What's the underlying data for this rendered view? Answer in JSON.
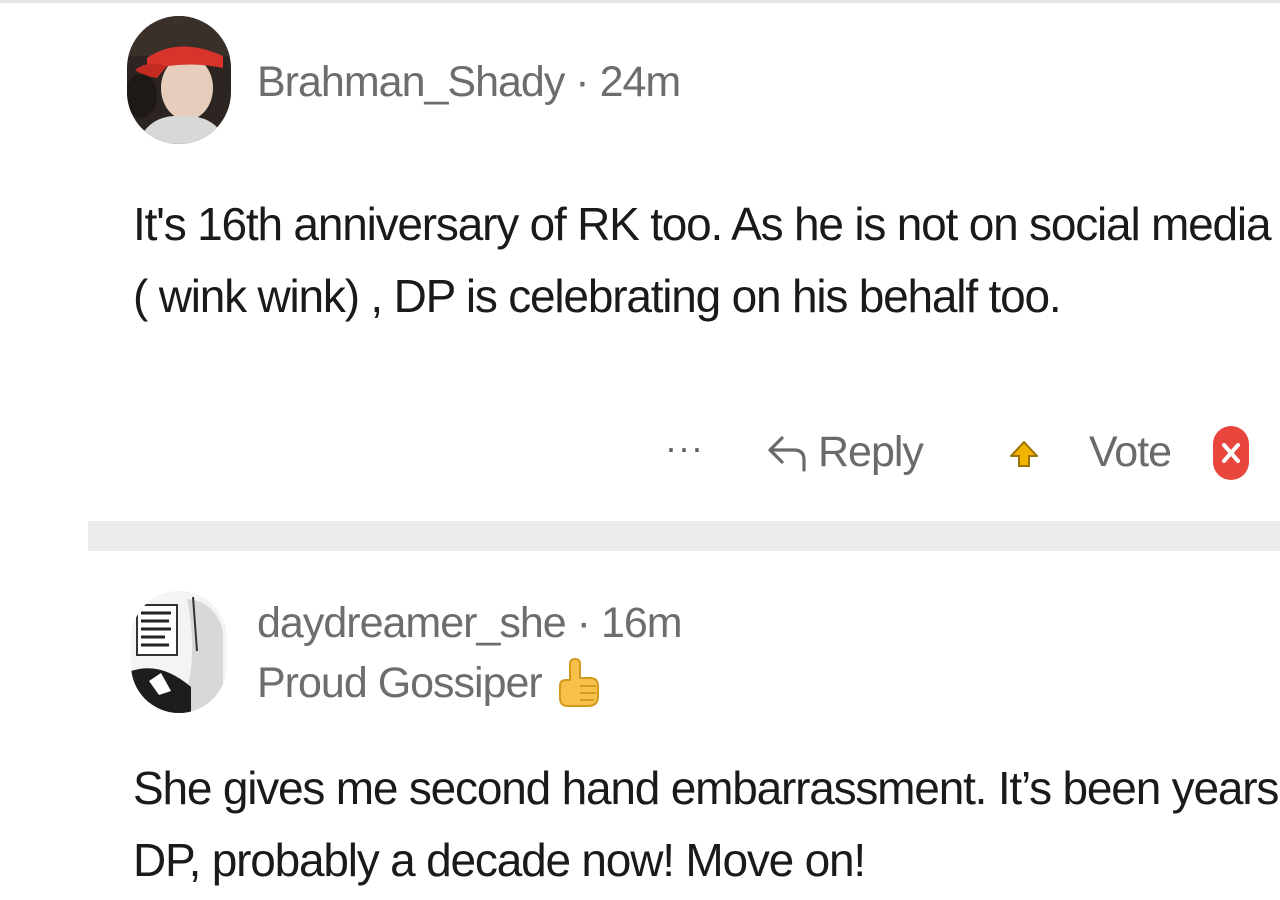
{
  "comments": [
    {
      "author": "Brahman_Shady",
      "separator": "·",
      "time": "24m",
      "body": "It's 16th anniversary of RK too. As he is not on social media ( wink wink) , DP is celebrating on his behalf too.",
      "actions": {
        "more": "···",
        "reply": "Reply",
        "vote": "Vote"
      },
      "avatar_icon": "user-avatar-red-cap"
    },
    {
      "author": "daydreamer_she",
      "separator": "·",
      "time": "16m",
      "flair": "Proud Gossiper",
      "flair_icon": "hand-pointing-emoji",
      "body": "She gives me second hand embarrassment. It’s been years DP, probably a decade now! Move on!",
      "avatar_icon": "user-avatar-manga"
    }
  ],
  "colors": {
    "meta_text": "#6d6d6d",
    "body_text": "#1a1a1a",
    "upvote": "#f0b400",
    "downvote": "#e8453c",
    "divider": "#ececec"
  }
}
